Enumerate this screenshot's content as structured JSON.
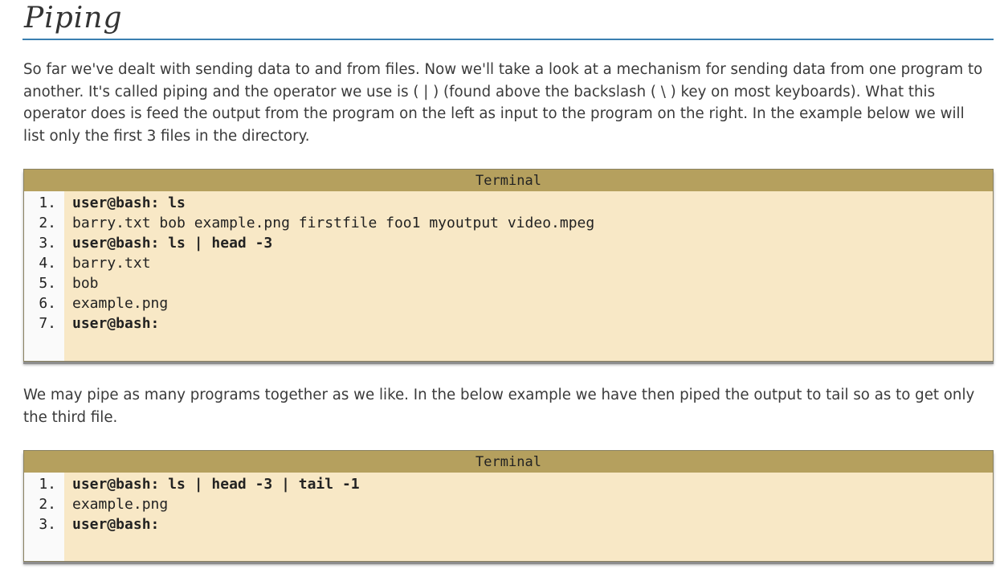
{
  "heading": "Piping",
  "paragraphs": {
    "p1": "So far we've dealt with sending data to and from files. Now we'll take a look at a mechanism for sending data from one program to another. It's called piping and the operator we use is ( | ) (found above the backslash ( \\ ) key on most keyboards). What this operator does is feed the output from the program on the left as input to the program on the right. In the example below we will list only the first 3 files in the directory.",
    "p2": "We may pipe as many programs together as we like. In the below example we have then piped the output to tail so as to get only the third file."
  },
  "terminals": [
    {
      "title": "Terminal",
      "lines": [
        {
          "num": "1.",
          "text": "user@bash: ls",
          "type": "cmd"
        },
        {
          "num": "2.",
          "text": "barry.txt bob example.png firstfile foo1 myoutput video.mpeg",
          "type": "out"
        },
        {
          "num": "3.",
          "text": "user@bash: ls | head -3",
          "type": "cmd"
        },
        {
          "num": "4.",
          "text": "barry.txt",
          "type": "out"
        },
        {
          "num": "5.",
          "text": "bob",
          "type": "out"
        },
        {
          "num": "6.",
          "text": "example.png",
          "type": "out"
        },
        {
          "num": "7.",
          "text": "user@bash:",
          "type": "cmd"
        }
      ]
    },
    {
      "title": "Terminal",
      "lines": [
        {
          "num": "1.",
          "text": "user@bash: ls | head -3 | tail -1",
          "type": "cmd"
        },
        {
          "num": "2.",
          "text": "example.png",
          "type": "out"
        },
        {
          "num": "3.",
          "text": "user@bash:",
          "type": "cmd"
        }
      ]
    }
  ],
  "colors": {
    "heading_rule": "#3a7fb0",
    "terminal_bg": "#f8e8c6",
    "terminal_title_bg": "#b5a05e"
  }
}
